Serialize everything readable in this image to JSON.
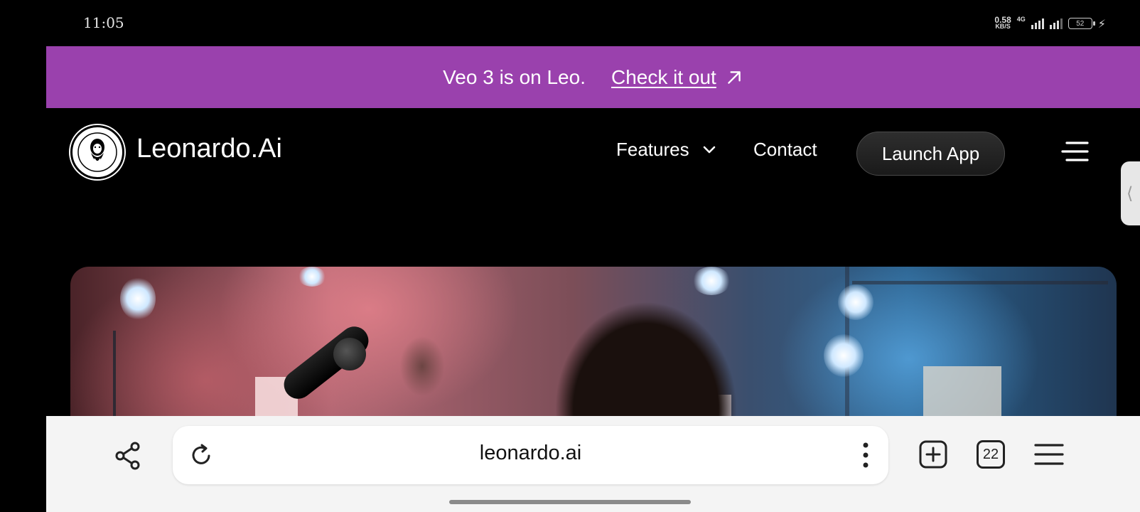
{
  "status_bar": {
    "time": "11:05",
    "net_speed": "0.58",
    "net_speed_unit": "KB/S",
    "network_type": "4G",
    "battery": "52"
  },
  "banner": {
    "text": "Veo 3 is on Leo.",
    "link": "Check it out",
    "background": "#9a41ad"
  },
  "nav": {
    "brand": "Leonardo.Ai",
    "features": "Features",
    "contact": "Contact",
    "launch": "Launch App"
  },
  "browser": {
    "url": "leonardo.ai",
    "tab_count": "22"
  },
  "icons": {
    "share": "share-icon",
    "reload": "reload-icon",
    "more": "more-vertical-icon",
    "new_tab": "new-tab-icon",
    "tabs": "tabs-icon",
    "menu": "menu-icon",
    "side_tab": "chevron-left-icon"
  }
}
